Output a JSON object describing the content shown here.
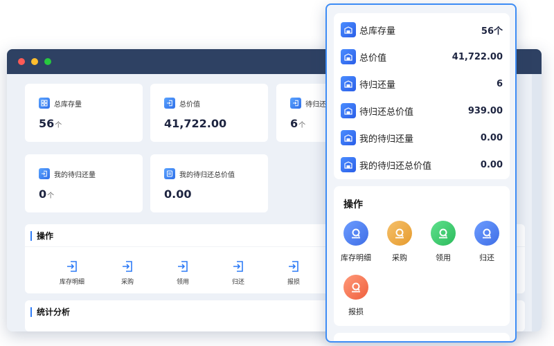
{
  "desktop": {
    "stats": [
      {
        "label": "总库存量",
        "value": "56",
        "unit": "个",
        "icon": "grid-icon"
      },
      {
        "label": "总价值",
        "value": "41,722.00",
        "unit": "",
        "icon": "login-icon"
      },
      {
        "label": "待归还",
        "value": "6",
        "unit": "个",
        "icon": "login-icon"
      },
      {
        "label": "我的待归还量",
        "value": "0",
        "unit": "个",
        "icon": "login-icon"
      },
      {
        "label": "我的待归还总价值",
        "value": "0.00",
        "unit": "",
        "icon": "list-icon"
      }
    ],
    "operations_title": "操作",
    "operations": [
      "库存明细",
      "采购",
      "领用",
      "归还",
      "报损"
    ],
    "analysis_title": "统计分析"
  },
  "mobile": {
    "stats": [
      {
        "label": "总库存量",
        "value": "56个"
      },
      {
        "label": "总价值",
        "value": "41,722.00"
      },
      {
        "label": "待归还量",
        "value": "6"
      },
      {
        "label": "待归还总价值",
        "value": "939.00"
      },
      {
        "label": "我的待归还量",
        "value": "0.00"
      },
      {
        "label": "我的待归还总价值",
        "value": "0.00"
      }
    ],
    "operations_title": "操作",
    "operations": [
      {
        "label": "库存明细",
        "color": "blue"
      },
      {
        "label": "采购",
        "color": "orange"
      },
      {
        "label": "领用",
        "color": "green"
      },
      {
        "label": "归还",
        "color": "blue"
      },
      {
        "label": "报损",
        "color": "red"
      }
    ]
  },
  "colors": {
    "titlebar": "#2e4163",
    "accent": "#2f7cf6",
    "value_text": "#1d2440"
  }
}
